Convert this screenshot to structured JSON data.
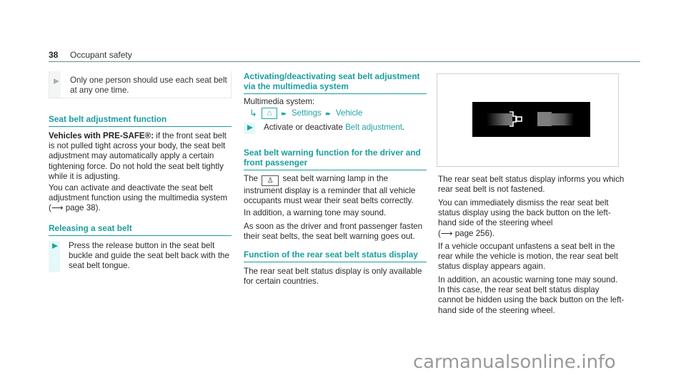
{
  "header": {
    "page_number": "38",
    "section": "Occupant safety"
  },
  "column1": {
    "note": "Only one person should use each seat belt at any one time.",
    "section1": {
      "heading": "Seat belt adjustment function",
      "lead_bold": "Vehicles with PRE-SAFE®:",
      "lead_text": " if the front seat belt is not pulled tight across your body, the seat belt adjustment may automatically apply a certain tightening force. Do not hold the seat belt tightly while it is adjusting.",
      "para2_text": "You can activate and deactivate the seat belt adjustment function using the multimedia system (",
      "para2_ref": "⟶ page 38",
      "para2_end": ")."
    },
    "section2": {
      "heading": "Releasing a seat belt",
      "step": "Press the release button in the seat belt buckle and guide the seat belt back with the seat belt tongue."
    }
  },
  "column2": {
    "section1": {
      "heading": "Activating/deactivating seat belt adjustment via the multimedia system",
      "intro": "Multimedia system:",
      "path": {
        "arrow": "↳",
        "home_icon": "⌂",
        "sep": "▸▸",
        "items": [
          "Settings",
          "Vehicle"
        ]
      },
      "step_pre": "Activate or deactivate ",
      "step_link": "Belt adjustment",
      "step_post": "."
    },
    "section2": {
      "heading": "Seat belt warning function for the driver and front passenger",
      "p1_pre": "The",
      "p1_icon": "seat-belt-warning-lamp",
      "p1_post": " seat belt warning lamp in the instrument display is a reminder that all vehicle occupants must wear their seat belts correctly.",
      "p2": "In addition, a warning tone may sound.",
      "p3": "As soon as the driver and front passenger fasten their seat belts, the seat belt warning goes out."
    },
    "section3": {
      "heading": "Function of the rear seat belt status display",
      "p1": "The rear seat belt status display is only available for certain countries."
    }
  },
  "column3": {
    "p1": "The rear seat belt status display informs you which rear seat belt is not fastened.",
    "p2_text": "You can immediately dismiss the rear seat belt status display using the back button on the left-hand side of the steering wheel",
    "p2_ref": "(⟶ page 256).",
    "p3": "If a vehicle occupant unfastens a seat belt in the rear while the vehicle is motion, the rear seat belt status display appears again.",
    "p4": "In addition, an acoustic warning tone may sound. In this case, the rear seat belt status display cannot be hidden using the back button on the left-hand side of the steering wheel."
  },
  "watermark": "carmanualsonline.info"
}
